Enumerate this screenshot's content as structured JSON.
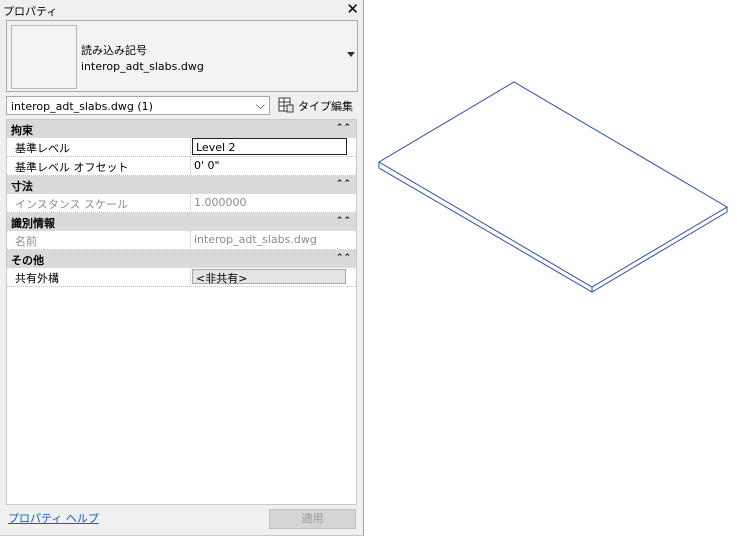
{
  "panel": {
    "title": "プロパティ",
    "close_icon": "close-icon"
  },
  "type_selector": {
    "family": "読み込み記号",
    "type_name": "interop_adt_slabs.dwg"
  },
  "instance_filter": {
    "value": "interop_adt_slabs.dwg (1)",
    "edit_type_label": "タイプ編集"
  },
  "groups": [
    {
      "label": "拘束",
      "params": [
        {
          "name": "基準レベル",
          "value": "Level 2"
        },
        {
          "name": "基準レベル オフセット",
          "value": "0'  0\""
        }
      ]
    },
    {
      "label": "寸法",
      "params": [
        {
          "name": "インスタンス スケール",
          "value": "1.000000"
        }
      ]
    },
    {
      "label": "識別情報",
      "params": [
        {
          "name": "名前",
          "value": "interop_adt_slabs.dwg"
        }
      ]
    },
    {
      "label": "その他",
      "params": [
        {
          "name": "共有外構",
          "value": "<非共有>"
        }
      ]
    }
  ],
  "footer": {
    "help_link": "プロパティ ヘルプ",
    "apply_label": "適用"
  },
  "colors": {
    "slab_edge": "#2b4ea8"
  }
}
